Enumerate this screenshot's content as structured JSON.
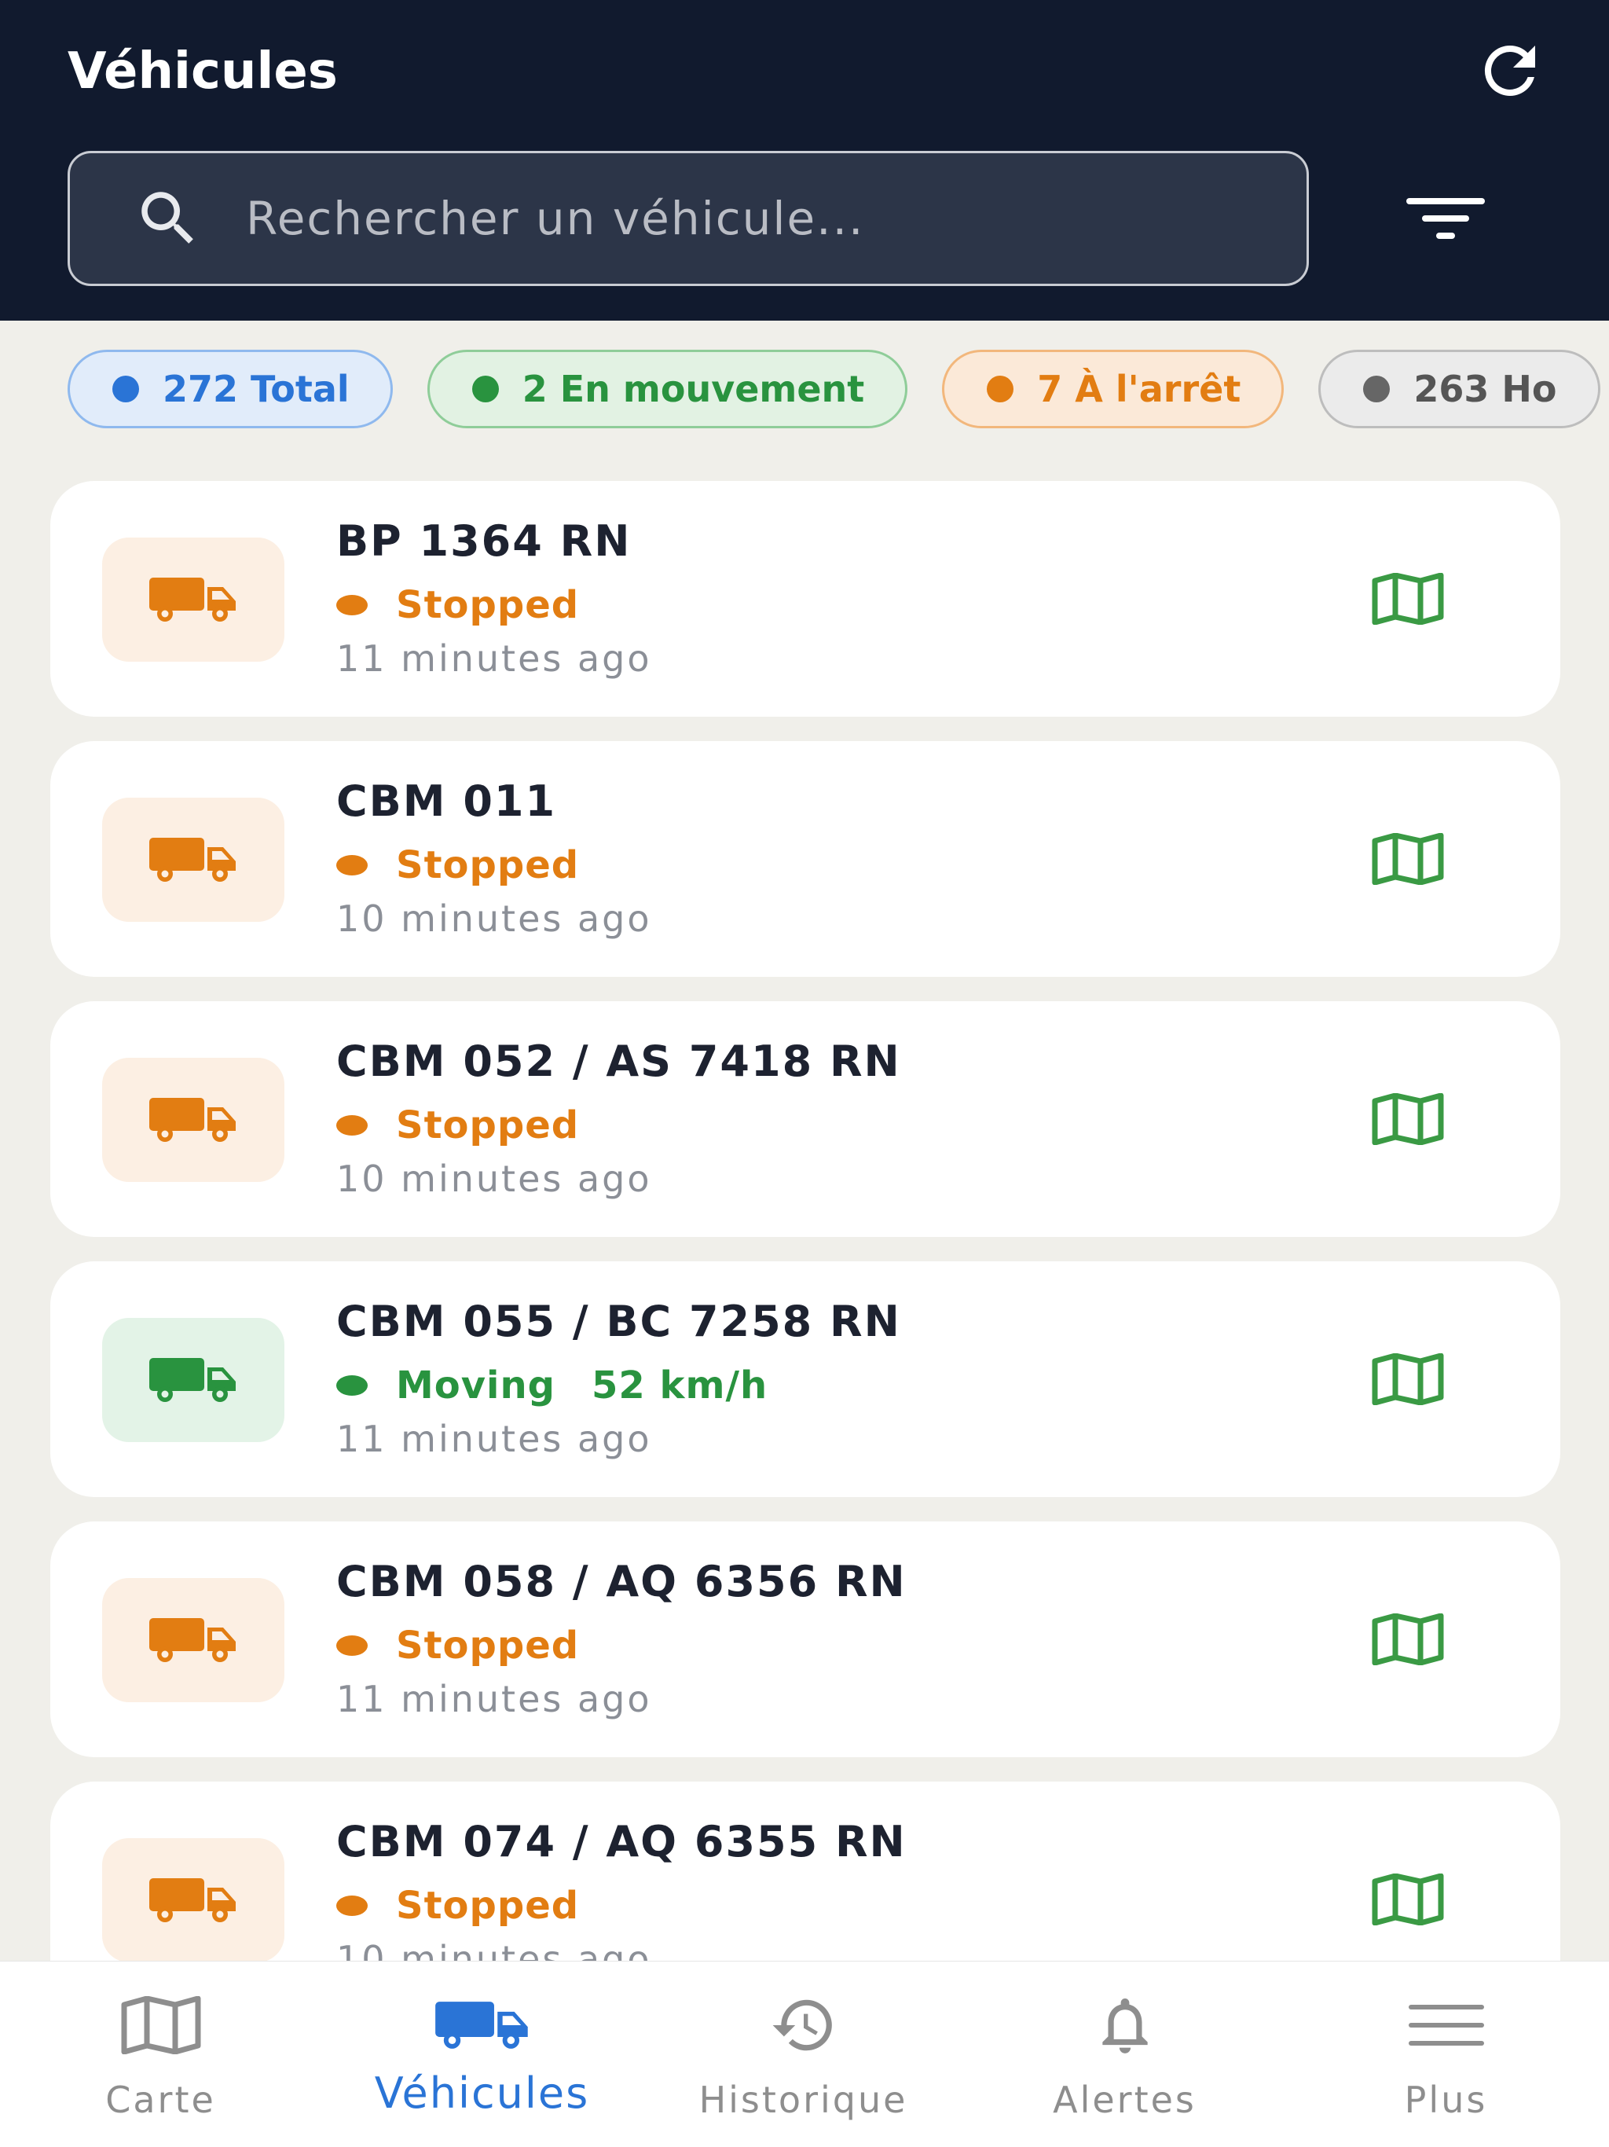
{
  "header": {
    "title": "Véhicules",
    "search_placeholder": "Rechercher un véhicule..."
  },
  "chips": [
    {
      "label": "272 Total",
      "count": 272,
      "color": "#2a74d6"
    },
    {
      "label": "2 En mouvement",
      "count": 2,
      "color": "#29933f"
    },
    {
      "label": "7 À l'arrêt",
      "count": 7,
      "color": "#e27d12"
    },
    {
      "label": "263 Ho",
      "count": 263,
      "color": "#666666"
    }
  ],
  "vehicles": [
    {
      "name": "BP 1364 RN",
      "status": "Stopped",
      "speed": "",
      "time": "11 minutes ago"
    },
    {
      "name": "CBM 011",
      "status": "Stopped",
      "speed": "",
      "time": "10 minutes ago"
    },
    {
      "name": "CBM 052 / AS 7418 RN",
      "status": "Stopped",
      "speed": "",
      "time": "10 minutes ago"
    },
    {
      "name": "CBM 055 / BC 7258 RN",
      "status": "Moving",
      "speed": "52 km/h",
      "time": "11 minutes ago"
    },
    {
      "name": "CBM 058 / AQ 6356 RN",
      "status": "Stopped",
      "speed": "",
      "time": "11 minutes ago"
    },
    {
      "name": "CBM 074 / AQ 6355 RN",
      "status": "Stopped",
      "speed": "",
      "time": "10 minutes ago"
    }
  ],
  "nav": [
    {
      "label": "Carte",
      "icon": "map-icon"
    },
    {
      "label": "Véhicules",
      "icon": "truck-icon",
      "active": true
    },
    {
      "label": "Historique",
      "icon": "history-icon"
    },
    {
      "label": "Alertes",
      "icon": "bell-icon"
    },
    {
      "label": "Plus",
      "icon": "menu-icon"
    }
  ],
  "colors": {
    "header_bg": "#111a2e",
    "stopped": "#e27d12",
    "moving": "#29933f",
    "accent": "#2a74d6",
    "map_icon": "#3a9a44"
  }
}
